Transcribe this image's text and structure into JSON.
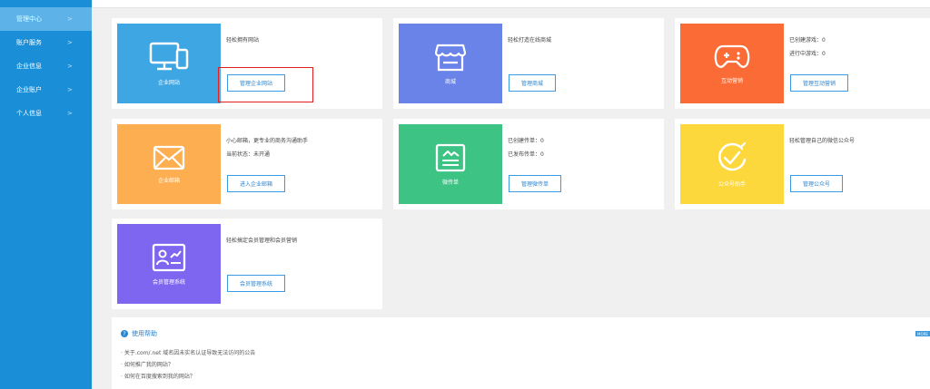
{
  "sidebar": {
    "items": [
      {
        "label": "管理中心",
        "chev": ">"
      },
      {
        "label": "账户服务",
        "chev": ">"
      },
      {
        "label": "企业信息",
        "chev": ">"
      },
      {
        "label": "企业账户",
        "chev": ">"
      },
      {
        "label": "个人信息",
        "chev": ">"
      }
    ]
  },
  "cards": [
    {
      "tile_label": "企业网站",
      "desc": [
        "轻松拥有网站"
      ],
      "button": "管理企业网站",
      "color": "#3ea6e2"
    },
    {
      "tile_label": "商城",
      "desc": [
        "轻松打造在线商城"
      ],
      "button": "管理商城",
      "color": "#6983e9"
    },
    {
      "tile_label": "互动营销",
      "desc": [
        "已创建游戏：0",
        "进行中游戏：0"
      ],
      "button": "管理互动营销",
      "color": "#fb6b35"
    },
    {
      "tile_label": "企业邮箱",
      "desc": [
        "小心邮箱，更专业的商务沟通助手",
        "当前状态：未开通"
      ],
      "button": "进入企业邮箱",
      "color": "#fdae51"
    },
    {
      "tile_label": "微传单",
      "desc": [
        "已创建传单：0",
        "已发布传单：0"
      ],
      "button": "管理微传单",
      "color": "#3dc384"
    },
    {
      "tile_label": "公众号助手",
      "desc": [
        "轻松管理自己的微信公众号"
      ],
      "button": "管理公众号",
      "color": "#fdd83d"
    },
    {
      "tile_label": "会员管理系统",
      "desc": [
        "轻松搞定会员管理和会员营销"
      ],
      "button": "会员管理系统",
      "color": "#7e66f0"
    }
  ],
  "help": {
    "title": "使用帮助",
    "more": "MORE",
    "items": [
      "关于.com/.net 域名因未实名认证导致无法访问的公告",
      "如何推广我的网站？",
      "如何在百度搜索到我的网站？"
    ]
  }
}
